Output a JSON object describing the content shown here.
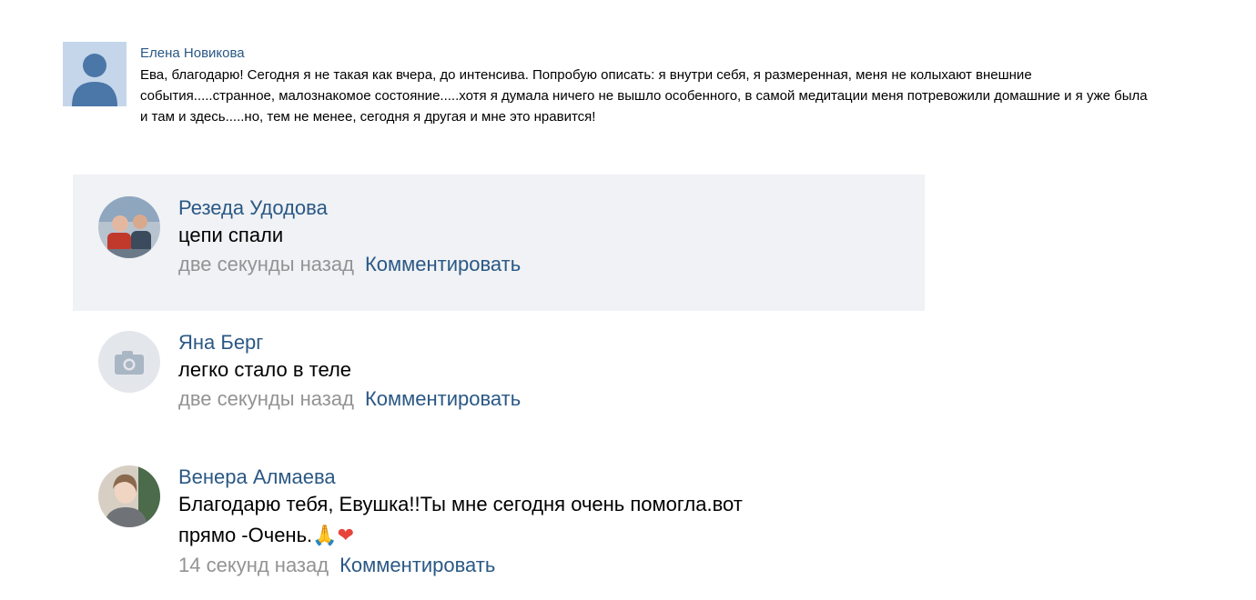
{
  "post": {
    "author": "Елена Новикова",
    "avatar_icon": "user-silhouette-icon",
    "text": "Ева, благодарю! Сегодня я не такая как вчера, до интенсива. Попробую описать: я внутри себя, я размеренная, меня не колыхают внешние события.....странное, малознакомое состояние.....хотя я думала ничего не вышло особенного, в самой медитации меня потревожили домашние и я уже была и там и здесь.....но, тем не менее, сегодня я другая и мне это нравится!"
  },
  "comments": [
    {
      "author": "Резеда Удодова",
      "text": "цепи спали",
      "time": "две секунды назад",
      "reply_label": "Комментировать"
    },
    {
      "author": "Яна Берг",
      "avatar_icon": "camera-icon",
      "text": "легко стало в теле",
      "time": "две секунды назад",
      "reply_label": "Комментировать"
    },
    {
      "author": "Венера Алмаева",
      "text_line1": "Благодарю тебя, Евушка!!Ты мне сегодня очень помогла.вот",
      "text_line2": "прямо -Очень.",
      "emoji1": "🙏",
      "emoji2": "❤",
      "time": "14 секунд назад",
      "reply_label": "Комментировать"
    }
  ],
  "colors": {
    "link": "#2a5885",
    "meta": "#939393",
    "highlight_bg": "#f0f2f5",
    "avatar_placeholder": "#c5d6ea"
  }
}
